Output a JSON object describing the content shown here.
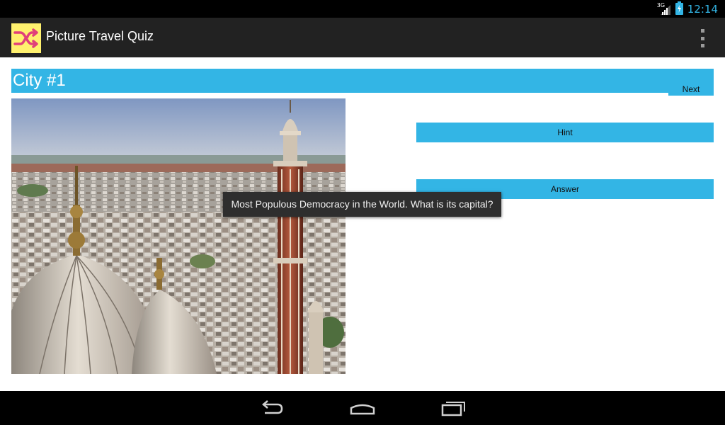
{
  "status_bar": {
    "network": "3G",
    "time": "12:14"
  },
  "action_bar": {
    "app_icon": "shuffle-icon",
    "title": "Picture Travel Quiz",
    "menu_icon": "overflow-menu-icon"
  },
  "quiz": {
    "city_title": "City #1",
    "next_label": "Next",
    "hint_label": "Hint",
    "answer_label": "Answer",
    "photo": "city-photo"
  },
  "toast": {
    "message": "Most Populous Democracy in the World. What is its capital?"
  },
  "nav_bar": {
    "icons": [
      "back-icon",
      "home-icon",
      "recent-apps-icon"
    ]
  },
  "colors": {
    "accent": "#33b5e5",
    "action_bar": "#222222",
    "app_icon_bg": "#fff16e",
    "app_icon_fg": "#e0407a"
  }
}
